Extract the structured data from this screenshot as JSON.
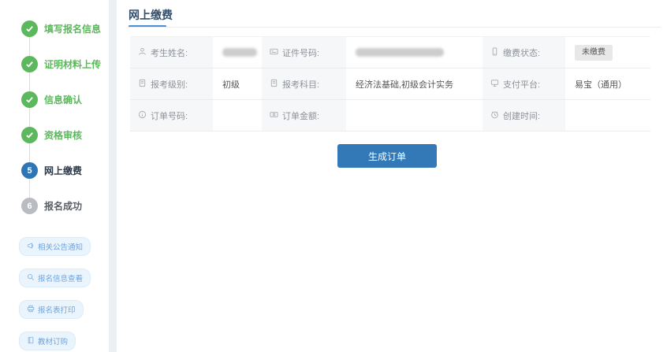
{
  "sidebar": {
    "steps": [
      {
        "num": "1",
        "label": "填写报名信息",
        "state": "done"
      },
      {
        "num": "2",
        "label": "证明材料上传",
        "state": "done"
      },
      {
        "num": "3",
        "label": "信息确认",
        "state": "done"
      },
      {
        "num": "4",
        "label": "资格审核",
        "state": "done"
      },
      {
        "num": "5",
        "label": "网上缴费",
        "state": "active"
      },
      {
        "num": "6",
        "label": "报名成功",
        "state": "pending"
      }
    ],
    "quick_links": [
      {
        "icon": "megaphone-icon",
        "label": "相关公告通知"
      },
      {
        "icon": "search-icon",
        "label": "报名信息查看"
      },
      {
        "icon": "printer-icon",
        "label": "报名表打印"
      },
      {
        "icon": "book-icon",
        "label": "教材订购"
      }
    ]
  },
  "main": {
    "title": "网上缴费",
    "info_table": {
      "rows": [
        [
          {
            "icon": "user-icon",
            "label": "考生姓名:",
            "value": "",
            "redacted": true
          },
          {
            "icon": "id-card-icon",
            "label": "证件号码:",
            "value": "",
            "redacted": true
          },
          {
            "icon": "mobile-icon",
            "label": "缴费状态:",
            "value": "未缴费",
            "badge": true
          }
        ],
        [
          {
            "icon": "document-icon",
            "label": "报考级别:",
            "value": "初级"
          },
          {
            "icon": "document-icon",
            "label": "报考科目:",
            "value": "经济法基础,初级会计实务"
          },
          {
            "icon": "monitor-icon",
            "label": "支付平台:",
            "value": "易宝（通用）"
          }
        ],
        [
          {
            "icon": "info-circle-icon",
            "label": "订单号码:",
            "value": ""
          },
          {
            "icon": "banknote-icon",
            "label": "订单金额:",
            "value": ""
          },
          {
            "icon": "clock-icon",
            "label": "创建时间:",
            "value": ""
          }
        ]
      ]
    },
    "generate_order_button": "生成订单"
  },
  "colors": {
    "success_green": "#5cb85c",
    "active_step_blue": "#2e75b6",
    "pending_gray": "#b9bdc2",
    "accent_button_blue": "#3379b8",
    "title_navy": "#31506e",
    "title_underline_blue": "#4a90d2",
    "pill_bg": "#eaf4fd",
    "pill_text": "#6fa3dd",
    "badge_bg": "#e8e8e8",
    "label_cell_bg": "#f6f7f8"
  }
}
